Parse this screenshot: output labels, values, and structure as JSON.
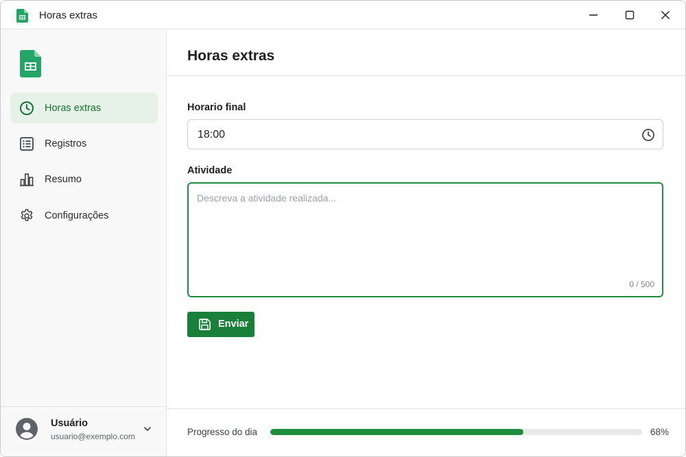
{
  "window": {
    "title": "Horas extras",
    "icon": "sheets-icon",
    "controls": [
      "minimize-icon",
      "maximize-icon",
      "close-icon"
    ]
  },
  "colors": {
    "accent": "#188038",
    "accent_light": "#e6f2e8",
    "sheets_green": "#0f9d58"
  },
  "sidebar": {
    "logo": "sheets-logo-icon",
    "items": [
      {
        "label": "Horas extras",
        "icon": "clock-icon",
        "active": true
      },
      {
        "label": "Registros",
        "icon": "list-icon",
        "active": false
      },
      {
        "label": "Resumo",
        "icon": "bar-chart-icon",
        "active": false
      },
      {
        "label": "Configurações",
        "icon": "gear-icon",
        "active": false
      }
    ],
    "user": {
      "name": "Usuário",
      "email": "usuario@exemplo.com",
      "avatar": "user-avatar-icon",
      "menu_icon": "chevron-down-icon"
    }
  },
  "main": {
    "title": "Horas extras",
    "time_field": {
      "label": "Horario final",
      "value": "18:00",
      "icon": "clock-icon"
    },
    "activity_field": {
      "label": "Atividade",
      "placeholder": "Descreva a atividade realizada...",
      "value": "",
      "counter": "0 / 500"
    },
    "submit": {
      "label": "Enviar",
      "icon": "save-icon"
    },
    "progress": {
      "label": "Progresso do dia",
      "value_text": "68%",
      "fraction": 0.68
    }
  }
}
